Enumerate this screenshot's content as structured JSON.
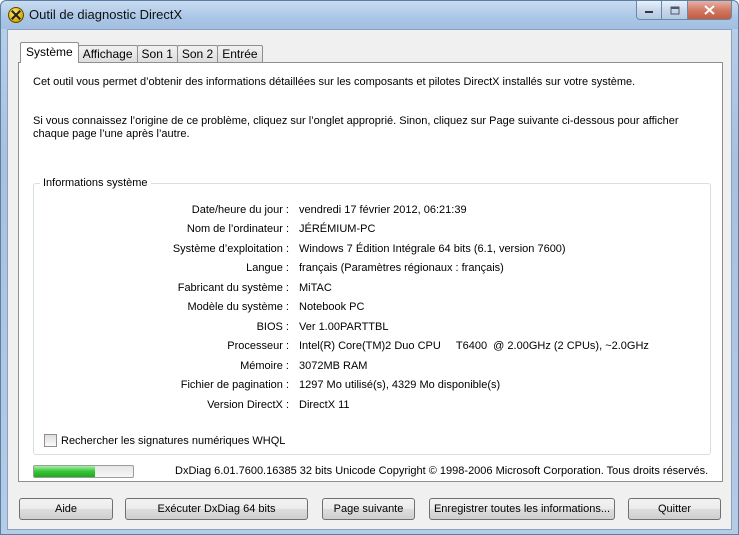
{
  "window": {
    "title": "Outil de diagnostic DirectX",
    "app_icon": "directx-icon",
    "caption_icons": [
      "minimize-icon",
      "maximize-icon",
      "close-icon"
    ]
  },
  "tabs": [
    {
      "label": "Système",
      "active": true
    },
    {
      "label": "Affichage",
      "active": false
    },
    {
      "label": "Son 1",
      "active": false
    },
    {
      "label": "Son 2",
      "active": false
    },
    {
      "label": "Entrée",
      "active": false
    }
  ],
  "intro": {
    "line1": "Cet outil vous permet d’obtenir des informations détaillées sur les composants et pilotes DirectX installés sur votre système.",
    "line2": "Si vous connaissez l’origine de ce problème, cliquez sur l’onglet approprié. Sinon, cliquez sur Page suivante ci-dessous pour afficher chaque page l’une après l’autre."
  },
  "system_info": {
    "title": "Informations système",
    "rows": [
      {
        "label": "Date/heure du jour :",
        "value": "vendredi 17 février 2012, 06:21:39"
      },
      {
        "label": "Nom de l’ordinateur :",
        "value": "JÉRÉMIUM-PC"
      },
      {
        "label": "Système d’exploitation :",
        "value": "Windows 7 Édition Intégrale 64 bits (6.1, version 7600)"
      },
      {
        "label": "Langue :",
        "value": "français (Paramètres régionaux : français)"
      },
      {
        "label": "Fabricant du système :",
        "value": "MiTAC"
      },
      {
        "label": "Modèle du système :",
        "value": "Notebook PC"
      },
      {
        "label": "BIOS :",
        "value": "Ver 1.00PARTTBL"
      },
      {
        "label": "Processeur :",
        "value": "Intel(R) Core(TM)2 Duo CPU     T6400  @ 2.00GHz (2 CPUs), ~2.0GHz"
      },
      {
        "label": "Mémoire :",
        "value": "3072MB RAM"
      },
      {
        "label": "Fichier de pagination :",
        "value": "1297 Mo utilisé(s), 4329 Mo disponible(s)"
      },
      {
        "label": "Version DirectX :",
        "value": "DirectX 11"
      }
    ],
    "whql_checkbox": {
      "label": "Rechercher les signatures numériques WHQL",
      "checked": false
    }
  },
  "status": {
    "progress_percent": 62,
    "progress_color": "#36c436",
    "version_text": "DxDiag 6.01.7600.16385 32 bits Unicode Copyright © 1998-2006 Microsoft Corporation. Tous droits réservés."
  },
  "buttons": {
    "help": "Aide",
    "run64": "Exécuter DxDiag 64 bits",
    "next_page": "Page suivante",
    "save_all": "Enregistrer toutes les informations...",
    "quit": "Quitter"
  }
}
